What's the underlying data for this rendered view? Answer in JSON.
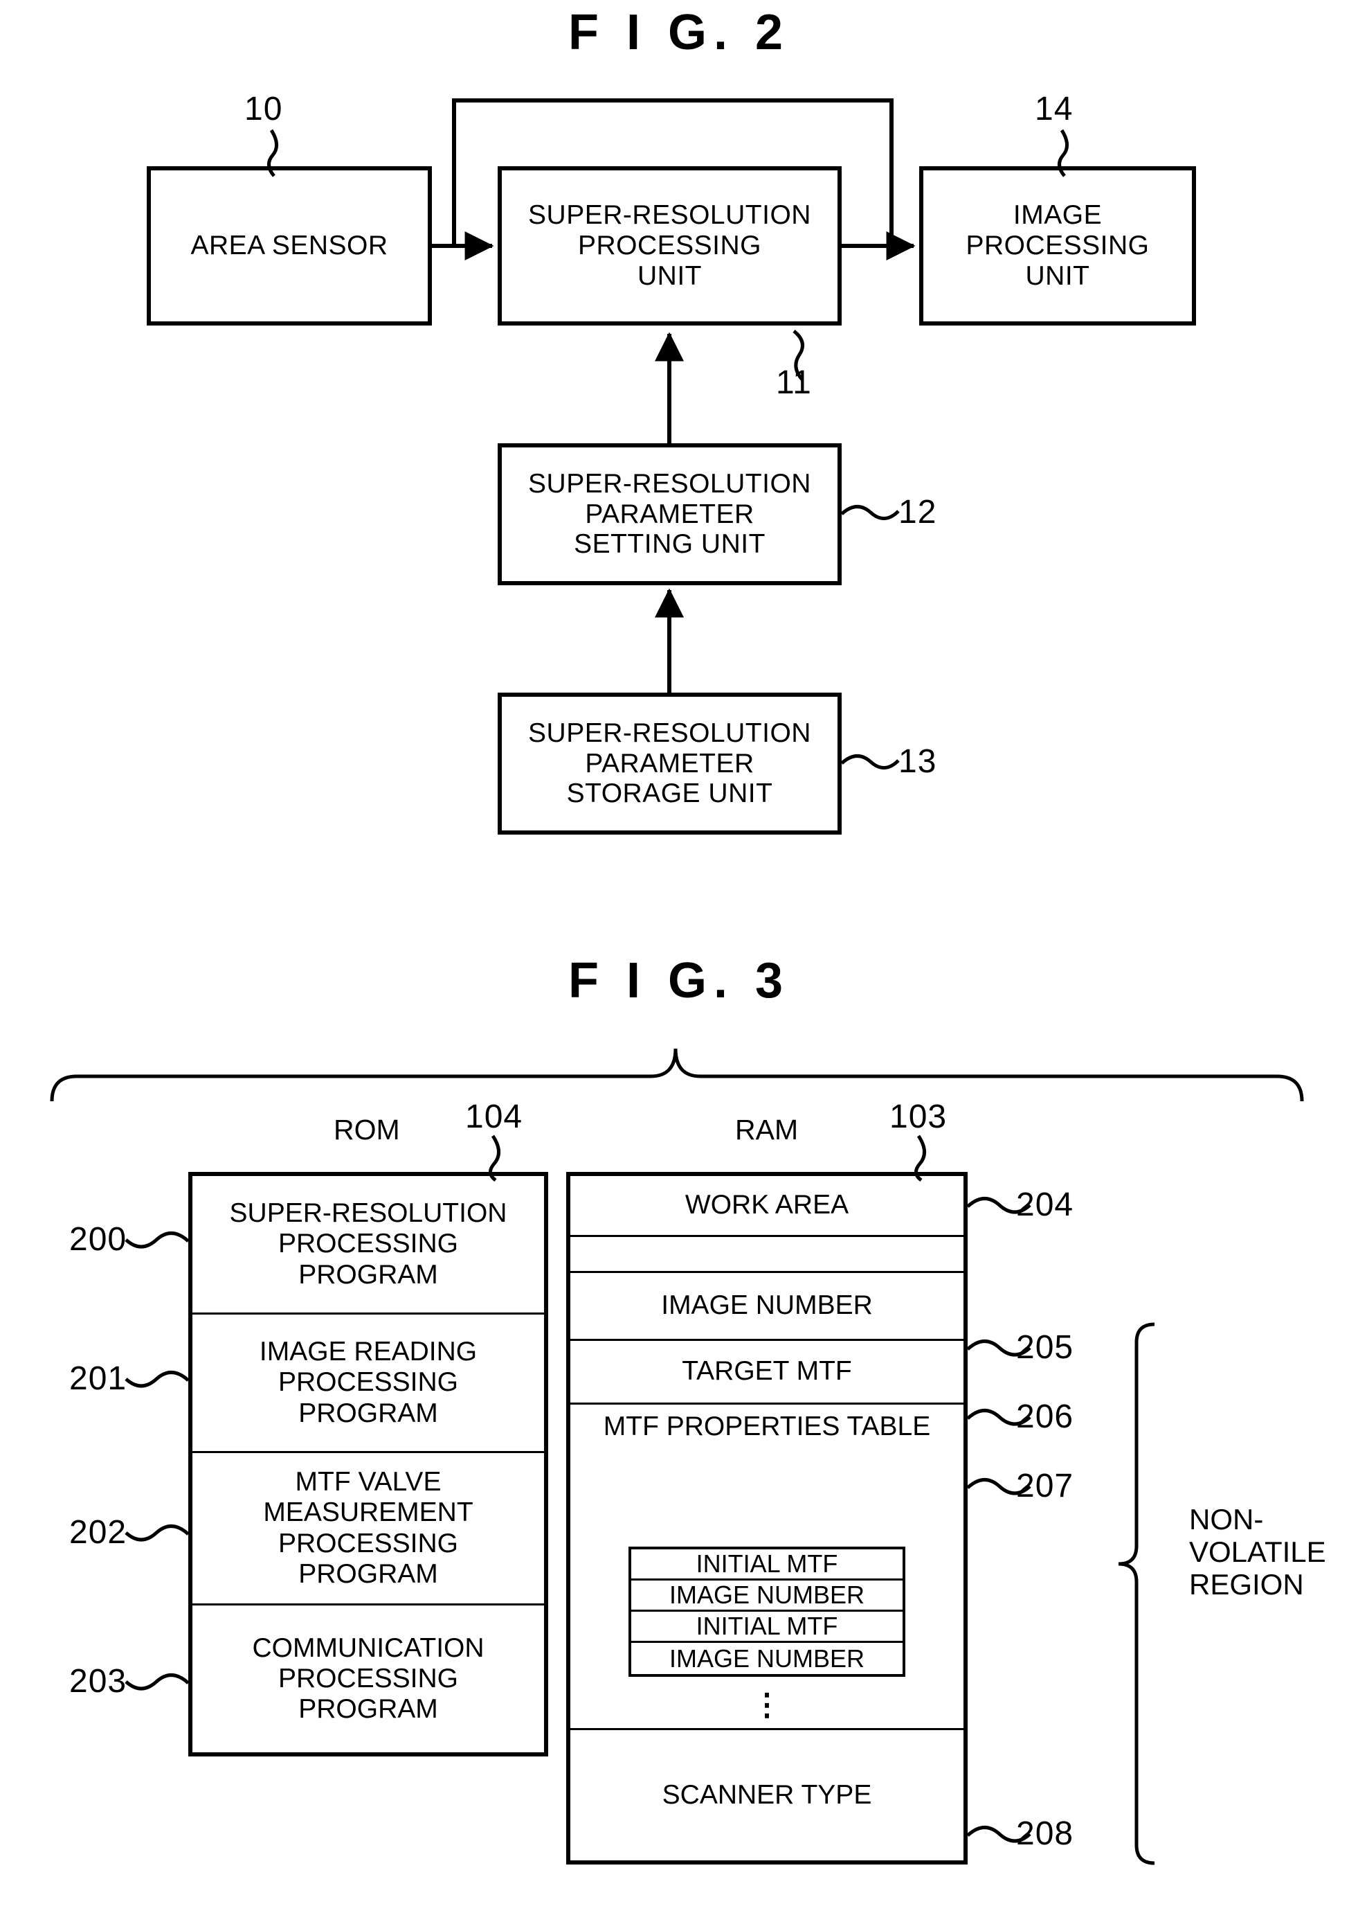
{
  "figures": [
    {
      "title": "F I G. 2",
      "blocks": [
        {
          "ref": "10",
          "label": "AREA SENSOR"
        },
        {
          "ref": "11",
          "label": "SUPER-RESOLUTION\nPROCESSING\nUNIT"
        },
        {
          "ref": "14",
          "label": "IMAGE\nPROCESSING\nUNIT"
        },
        {
          "ref": "12",
          "label": "SUPER-RESOLUTION\nPARAMETER\nSETTING UNIT"
        },
        {
          "ref": "13",
          "label": "SUPER-RESOLUTION\nPARAMETER\nSTORAGE UNIT"
        }
      ]
    },
    {
      "title": "F I G. 3",
      "rom": {
        "header": "ROM",
        "ref": "104",
        "rows": [
          {
            "ref": "200",
            "label": "SUPER-RESOLUTION\nPROCESSING\nPROGRAM"
          },
          {
            "ref": "201",
            "label": "IMAGE READING\nPROCESSING\nPROGRAM"
          },
          {
            "ref": "202",
            "label": "MTF VALVE\nMEASUREMENT\nPROCESSING\nPROGRAM"
          },
          {
            "ref": "203",
            "label": "COMMUNICATION\nPROCESSING\nPROGRAM"
          }
        ]
      },
      "ram": {
        "header": "RAM",
        "ref": "103",
        "rows": [
          {
            "ref": "204",
            "label": "WORK AREA"
          },
          {
            "ref": "",
            "label": ""
          },
          {
            "ref": "205",
            "label": "IMAGE NUMBER"
          },
          {
            "ref": "206",
            "label": "TARGET MTF"
          },
          {
            "ref": "207",
            "label": "MTF PROPERTIES TABLE"
          },
          {
            "ref": "208",
            "label": "SCANNER TYPE"
          }
        ],
        "mtf_properties_table": {
          "entries": [
            "INITIAL MTF",
            "IMAGE NUMBER",
            "INITIAL MTF",
            "IMAGE NUMBER"
          ],
          "continuation": "⋮"
        },
        "region_note": "NON-\nVOLATILE\nREGION"
      }
    }
  ]
}
